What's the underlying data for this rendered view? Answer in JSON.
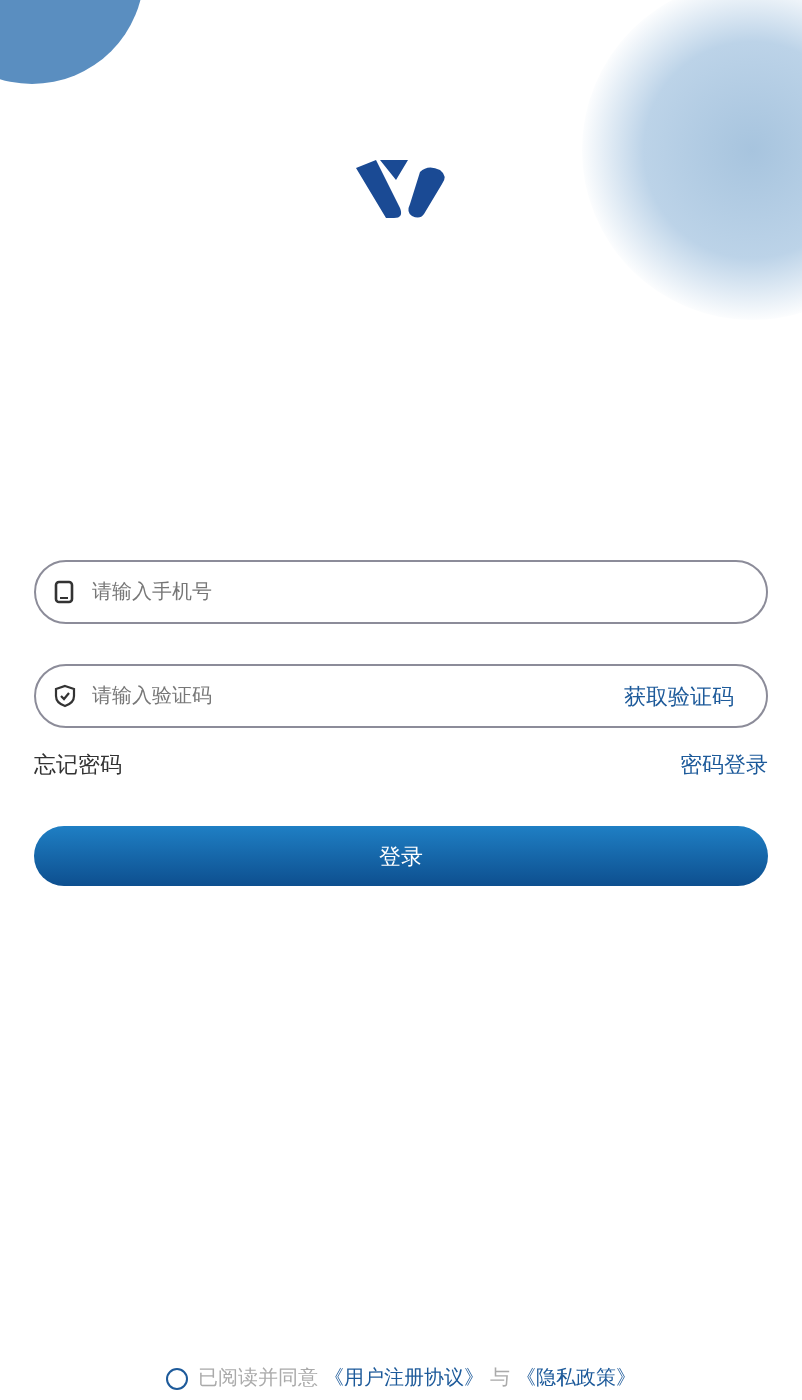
{
  "phone_field": {
    "placeholder": "请输入手机号"
  },
  "code_field": {
    "placeholder": "请输入验证码",
    "action": "获取验证码"
  },
  "forgot_password": "忘记密码",
  "password_login": "密码登录",
  "login_button": "登录",
  "agreement": {
    "checked": false,
    "prefix": "已阅读并同意",
    "terms": "《用户注册协议》",
    "joiner": "与",
    "privacy": "《隐私政策》"
  }
}
